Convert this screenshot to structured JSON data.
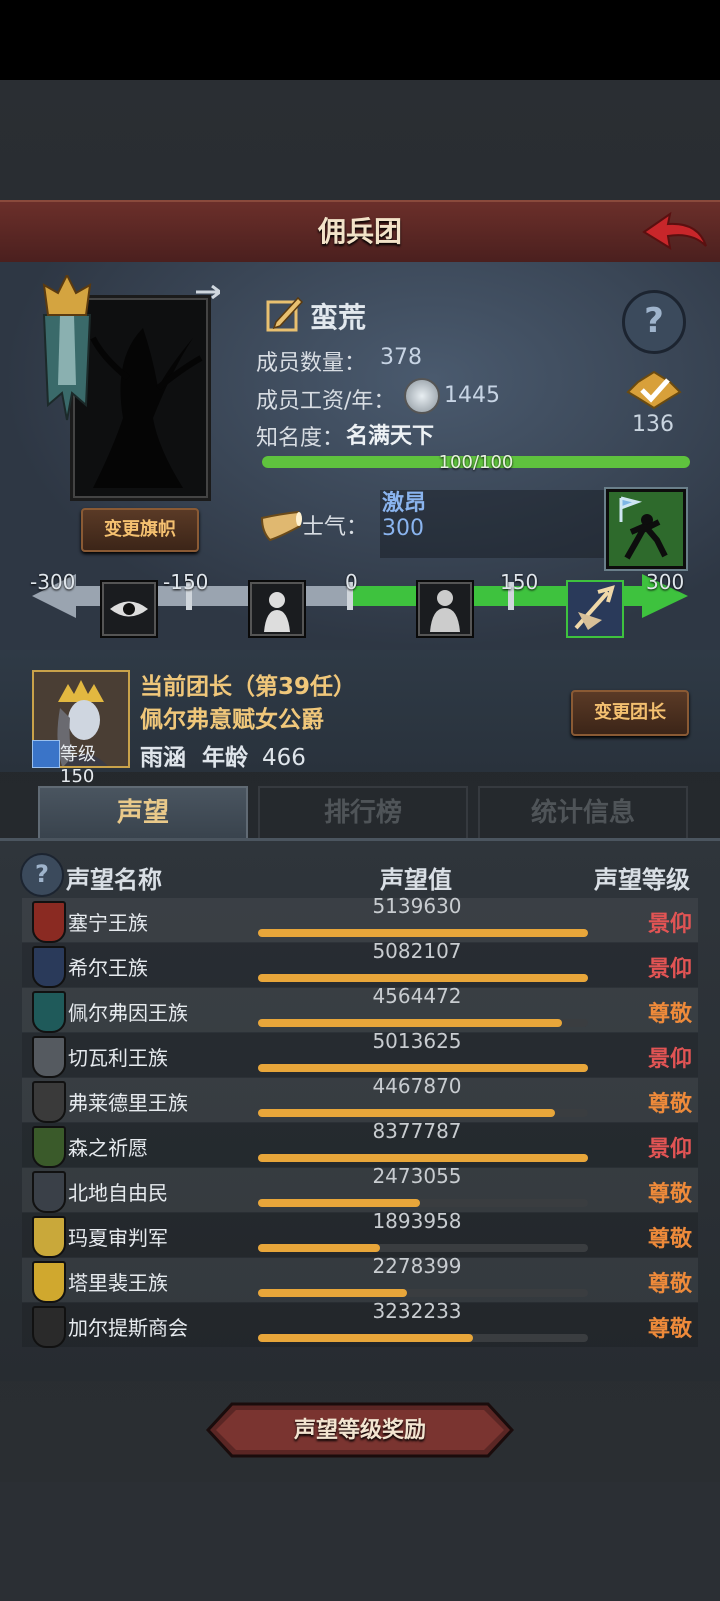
{
  "header": {
    "title": "佣兵团"
  },
  "band": {
    "change_flag_label": "变更旗帜",
    "name": "蛮荒",
    "members_label": "成员数量：",
    "members_value": "378",
    "salary_label": "成员工资/年：",
    "salary_value": "1445",
    "fame_label": "知名度：",
    "fame_value": "名满天下",
    "fame_progress": "100/100",
    "fame_fraction": 1.0,
    "badge_count": "136"
  },
  "morale": {
    "label": "士气：",
    "status": "激昂",
    "value": "300",
    "scale_ticks": [
      "-300",
      "-150",
      "0",
      "150",
      "300"
    ]
  },
  "leader": {
    "title": "当前团长（第39任）",
    "name": "佩尔弗意赋女公爵",
    "level": "等级150",
    "trait": "雨涵",
    "age_label": "年龄",
    "age": "466",
    "change_leader_label": "变更团长"
  },
  "tabs": [
    "声望",
    "排行榜",
    "统计信息"
  ],
  "table": {
    "headers": [
      "声望名称",
      "声望值",
      "声望等级"
    ],
    "rows": [
      {
        "name": "塞宁王族",
        "value": "5139630",
        "fill": 1.0,
        "grade": "景仰",
        "grade_color": "#e25454",
        "icon_color": "#8a2a22"
      },
      {
        "name": "希尔王族",
        "value": "5082107",
        "fill": 1.0,
        "grade": "景仰",
        "grade_color": "#e25454",
        "icon_color": "#2a3a5a"
      },
      {
        "name": "佩尔弗因王族",
        "value": "4564472",
        "fill": 0.92,
        "grade": "尊敬",
        "grade_color": "#ee8a3a",
        "icon_color": "#1f5a5a"
      },
      {
        "name": "切瓦利王族",
        "value": "5013625",
        "fill": 1.0,
        "grade": "景仰",
        "grade_color": "#e25454",
        "icon_color": "#555a60"
      },
      {
        "name": "弗莱德里王族",
        "value": "4467870",
        "fill": 0.9,
        "grade": "尊敬",
        "grade_color": "#ee8a3a",
        "icon_color": "#3a3a3a"
      },
      {
        "name": "森之祈愿",
        "value": "8377787",
        "fill": 1.0,
        "grade": "景仰",
        "grade_color": "#e25454",
        "icon_color": "#3a5a2a"
      },
      {
        "name": "北地自由民",
        "value": "2473055",
        "fill": 0.49,
        "grade": "尊敬",
        "grade_color": "#ee8a3a",
        "icon_color": "#3a4048"
      },
      {
        "name": "玛夏审判军",
        "value": "1893958",
        "fill": 0.37,
        "grade": "尊敬",
        "grade_color": "#ee8a3a",
        "icon_color": "#c9a83a"
      },
      {
        "name": "塔里裴王族",
        "value": "2278399",
        "fill": 0.45,
        "grade": "尊敬",
        "grade_color": "#ee8a3a",
        "icon_color": "#d0a82e"
      },
      {
        "name": "加尔提斯商会",
        "value": "3232233",
        "fill": 0.65,
        "grade": "尊敬",
        "grade_color": "#ee8a3a",
        "icon_color": "#2a2a2a"
      }
    ]
  },
  "footer": {
    "reward_label": "声望等级奖励"
  }
}
